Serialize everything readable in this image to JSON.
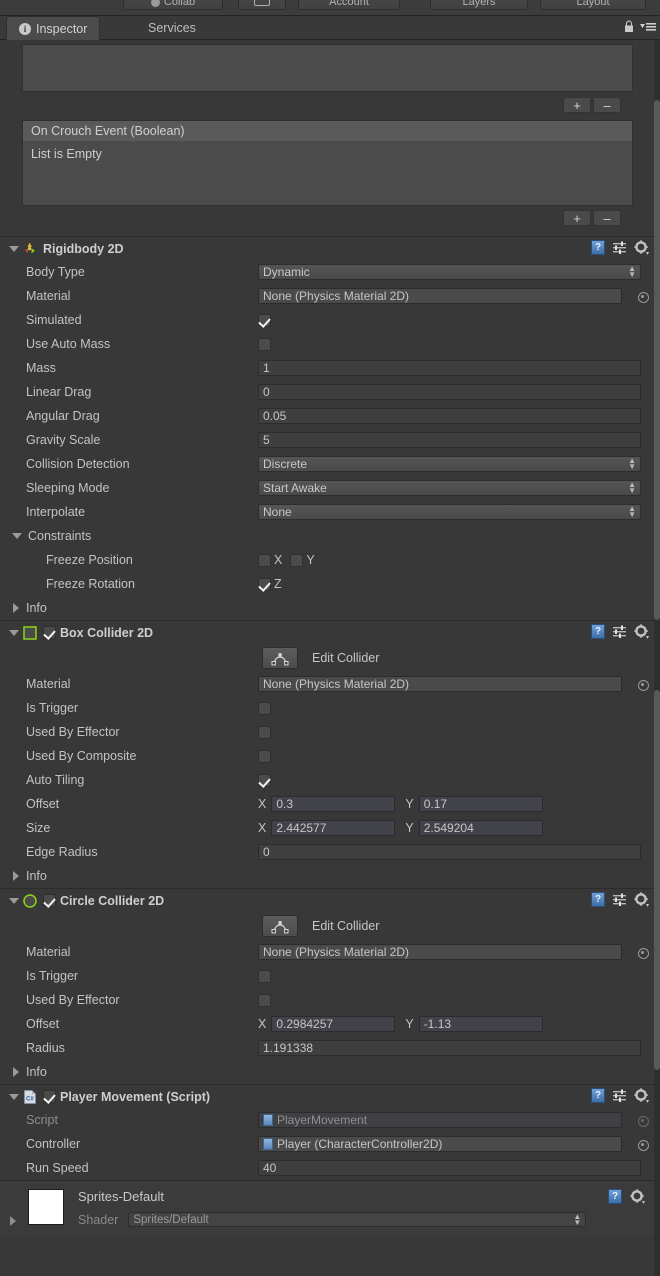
{
  "toolbar": {
    "collab_label": "Collab",
    "cloud_label": "",
    "account_label": "Account",
    "layers_label": "Layers",
    "layout_label": "Layout"
  },
  "tabs": {
    "inspector": "Inspector",
    "services": "Services",
    "info_glyph": "i"
  },
  "event_section": {
    "plus": "+",
    "minus": "–",
    "header": "On Crouch Event (Boolean)",
    "empty": "List is Empty"
  },
  "components": [
    {
      "title": "Rigidbody 2D",
      "icon": "rigidbody2d-icon",
      "has_enable_checkbox": false,
      "rows": [
        {
          "kind": "dropdown",
          "label": "Body Type",
          "value": "Dynamic"
        },
        {
          "kind": "object",
          "label": "Material",
          "value": "None (Physics Material 2D)"
        },
        {
          "kind": "checkbox",
          "label": "Simulated",
          "checked": true
        },
        {
          "kind": "checkbox",
          "label": "Use Auto Mass",
          "checked": false
        },
        {
          "kind": "number",
          "label": "Mass",
          "value": "1"
        },
        {
          "kind": "number",
          "label": "Linear Drag",
          "value": "0"
        },
        {
          "kind": "number",
          "label": "Angular Drag",
          "value": "0.05"
        },
        {
          "kind": "number",
          "label": "Gravity Scale",
          "value": "5"
        },
        {
          "kind": "dropdown",
          "label": "Collision Detection",
          "value": "Discrete"
        },
        {
          "kind": "dropdown",
          "label": "Sleeping Mode",
          "value": "Start Awake"
        },
        {
          "kind": "dropdown",
          "label": "Interpolate",
          "value": "None"
        }
      ],
      "constraints": {
        "label": "Constraints",
        "freeze_position_label": "Freeze Position",
        "freeze_position_x_label": "X",
        "freeze_position_x": false,
        "freeze_position_y_label": "Y",
        "freeze_position_y": false,
        "freeze_rotation_label": "Freeze Rotation",
        "freeze_rotation_z_label": "Z",
        "freeze_rotation_z": true
      },
      "info_label": "Info"
    },
    {
      "title": "Box Collider 2D",
      "icon": "box-collider-2d-icon",
      "has_enable_checkbox": true,
      "enabled": true,
      "edit_collider_label": "Edit Collider",
      "rows": [
        {
          "kind": "object",
          "label": "Material",
          "value": "None (Physics Material 2D)"
        },
        {
          "kind": "checkbox",
          "label": "Is Trigger",
          "checked": false
        },
        {
          "kind": "checkbox",
          "label": "Used By Effector",
          "checked": false
        },
        {
          "kind": "checkbox",
          "label": "Used By Composite",
          "checked": false
        },
        {
          "kind": "checkbox",
          "label": "Auto Tiling",
          "checked": true
        },
        {
          "kind": "vector2",
          "label": "Offset",
          "x_label": "X",
          "x": "0.3",
          "y_label": "Y",
          "y": "0.17"
        },
        {
          "kind": "vector2",
          "label": "Size",
          "x_label": "X",
          "x": "2.442577",
          "y_label": "Y",
          "y": "2.549204"
        },
        {
          "kind": "number",
          "label": "Edge Radius",
          "value": "0"
        }
      ],
      "info_label": "Info"
    },
    {
      "title": "Circle Collider 2D",
      "icon": "circle-collider-2d-icon",
      "has_enable_checkbox": true,
      "enabled": true,
      "edit_collider_label": "Edit Collider",
      "rows": [
        {
          "kind": "object",
          "label": "Material",
          "value": "None (Physics Material 2D)"
        },
        {
          "kind": "checkbox",
          "label": "Is Trigger",
          "checked": false
        },
        {
          "kind": "checkbox",
          "label": "Used By Effector",
          "checked": false
        },
        {
          "kind": "vector2",
          "label": "Offset",
          "x_label": "X",
          "x": "0.2984257",
          "y_label": "Y",
          "y": "-1.13"
        },
        {
          "kind": "number",
          "label": "Radius",
          "value": "1.191338"
        }
      ],
      "info_label": "Info"
    },
    {
      "title": "Player Movement (Script)",
      "icon": "csharp-script-icon",
      "has_enable_checkbox": true,
      "enabled": true,
      "rows": [
        {
          "kind": "script",
          "label": "Script",
          "value": "PlayerMovement"
        },
        {
          "kind": "object",
          "label": "Controller",
          "value": "Player (CharacterController2D)"
        },
        {
          "kind": "number",
          "label": "Run Speed",
          "value": "40"
        }
      ]
    }
  ],
  "material_footer": {
    "name": "Sprites-Default",
    "shader_label": "Shader",
    "shader_value": "Sprites/Default"
  },
  "colors": {
    "background": "#383838",
    "panel": "#3c3c3c",
    "field": "#42424a",
    "accent_green": "#8cd418",
    "help_blue": "#4f80bb",
    "text": "#c3c3c3"
  }
}
